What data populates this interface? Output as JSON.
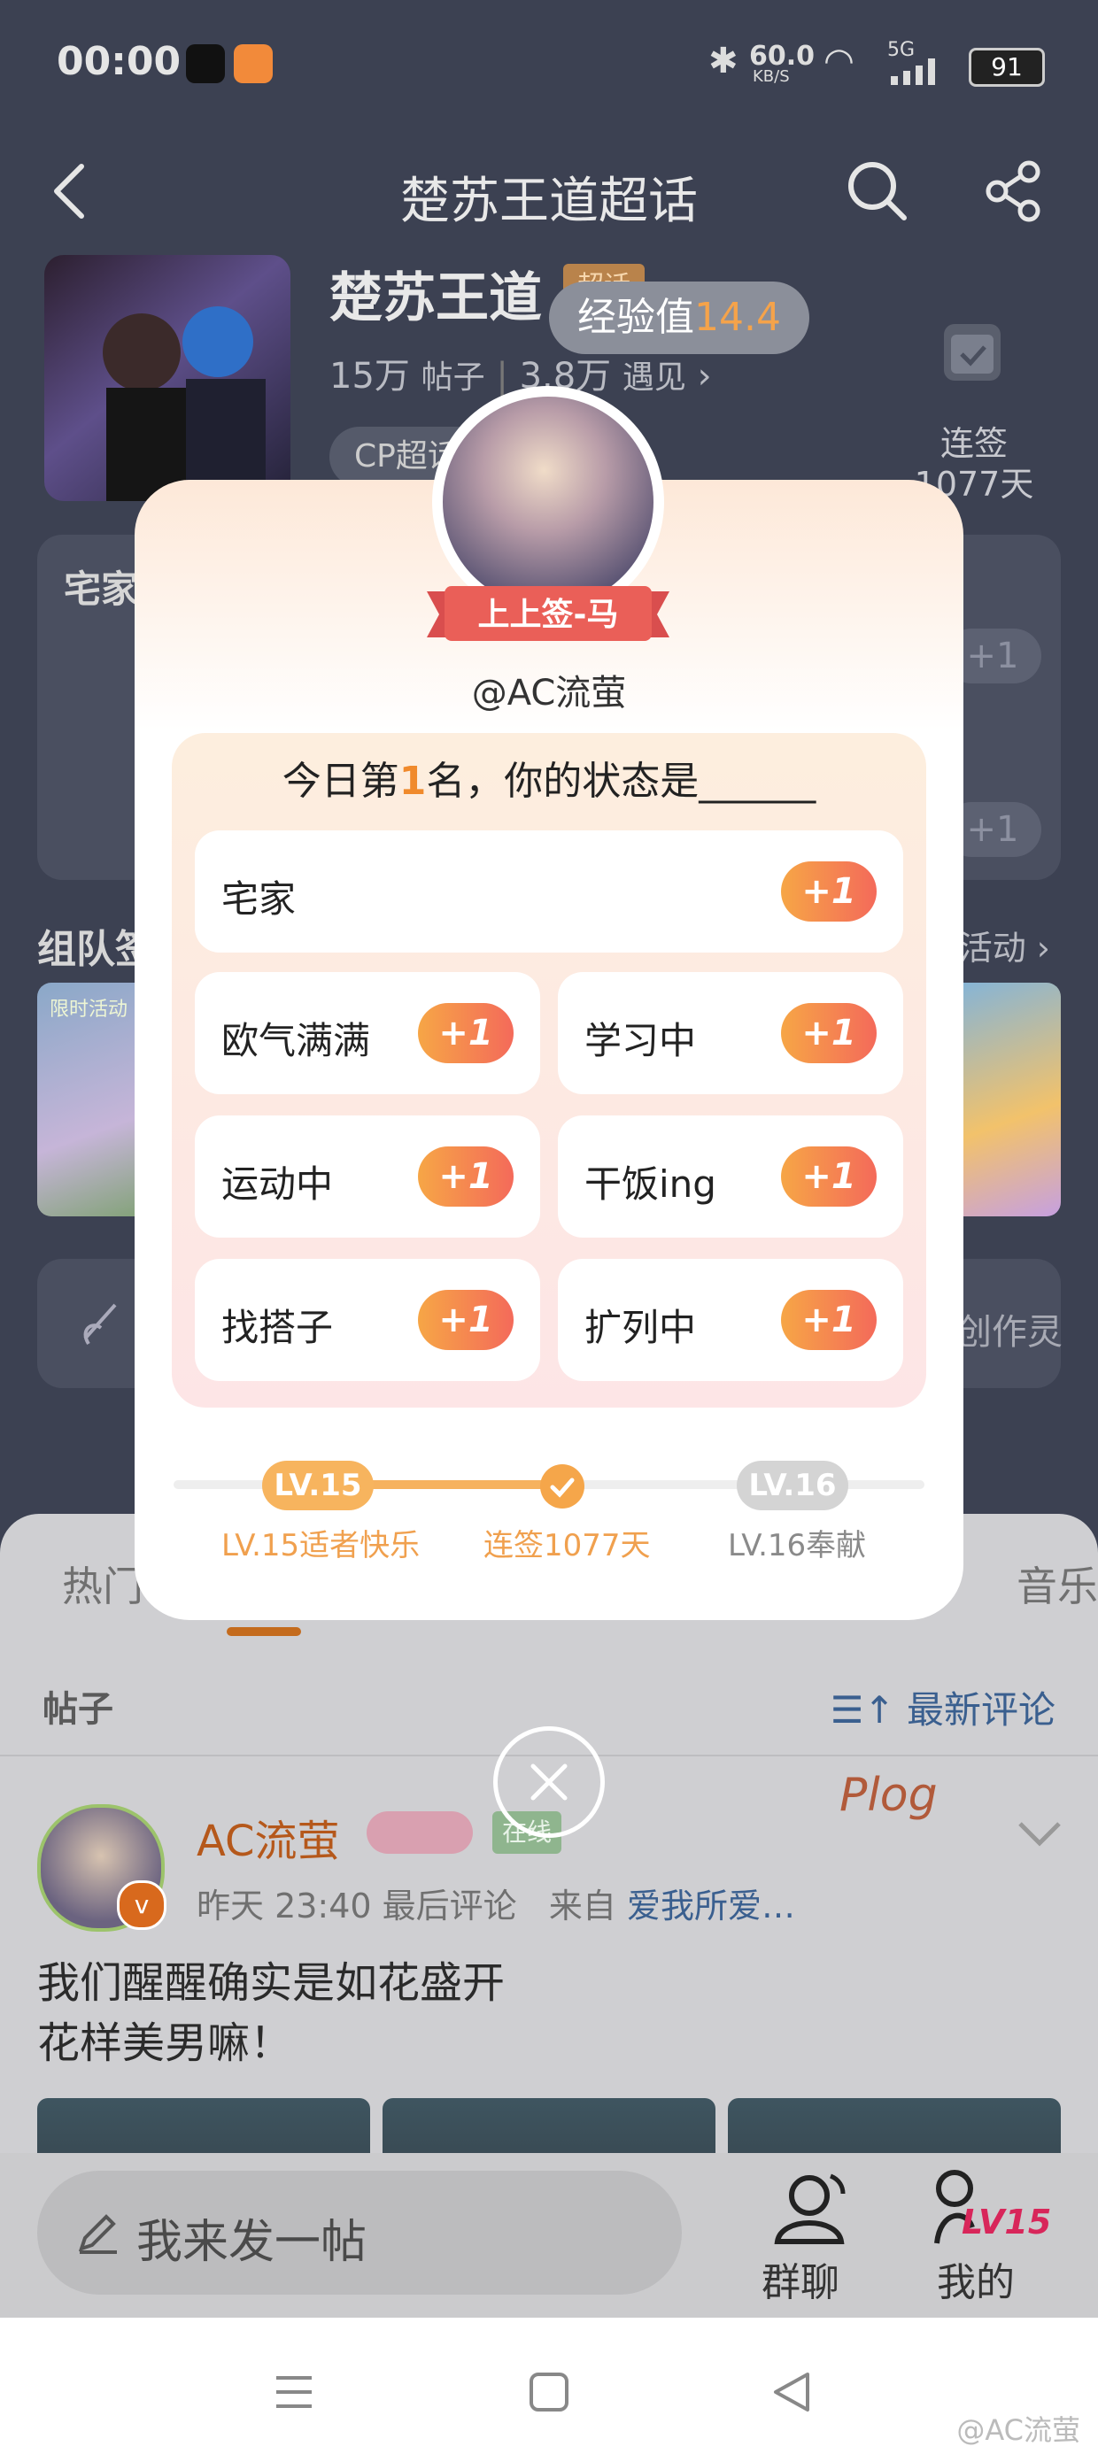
{
  "status_bar": {
    "time": "00:00",
    "net_speed": "60.0",
    "net_unit": "KB/S",
    "signal": "5G",
    "battery": "91"
  },
  "header": {
    "title": "楚苏王道超话"
  },
  "topic": {
    "name": "楚苏王道",
    "badge": "超话",
    "posts_count": "15万",
    "posts_label": "帖子",
    "meet_count": "3.8万",
    "meet_label": "遇见",
    "chip": "CP超话",
    "checkin_label": "连签",
    "checkin_days": "1077天"
  },
  "exp_toast": {
    "label": "经验值",
    "value": "14.4"
  },
  "background_cards": {
    "status_label": "宅家",
    "plus_label": "+1",
    "team_title": "组队签",
    "team_more": "活动",
    "team_tag": "限时活动",
    "create_text": "创作灵"
  },
  "modal": {
    "ribbon": "上上签-马",
    "handle": "@AC流萤",
    "question_prefix": "今日第",
    "question_rank": "1",
    "question_suffix": "名，你的状态是______",
    "options": [
      {
        "label": "宅家",
        "plus": "+1"
      },
      {
        "label": "欧气满满",
        "plus": "+1"
      },
      {
        "label": "学习中",
        "plus": "+1"
      },
      {
        "label": "运动中",
        "plus": "+1"
      },
      {
        "label": "干饭ing",
        "plus": "+1"
      },
      {
        "label": "找搭子",
        "plus": "+1"
      },
      {
        "label": "扩列中",
        "plus": "+1"
      }
    ],
    "progress": {
      "current_level": "LV.15",
      "next_level": "LV.16",
      "current_title": "LV.15适者快乐",
      "streak": "连签1077天",
      "next_title": "LV.16奉献",
      "fill_fraction": 0.52
    }
  },
  "tabs": {
    "hot": "热门",
    "music": "音乐"
  },
  "feed": {
    "section_label": "帖子",
    "sort_label": "最新评论",
    "post": {
      "author": "AC流萤",
      "online_badge": "在线",
      "time": "昨天 23:40 最后评论",
      "from_prefix": "来自",
      "from_source": "爱我所爱…",
      "text_line1": "我们醒醒确实是如花盛开",
      "text_line2": "花样美男嘛！",
      "sticker": "Plog"
    }
  },
  "bottom_bar": {
    "compose_placeholder": "我来发一帖",
    "groupchat": "群聊",
    "mine": "我的",
    "mine_level": "LV15"
  },
  "watermark": "@AC流萤",
  "colors": {
    "accent_orange": "#f5a64a",
    "plus_gradient_end": "#f46a5a",
    "link_blue": "#3a5f8f"
  }
}
